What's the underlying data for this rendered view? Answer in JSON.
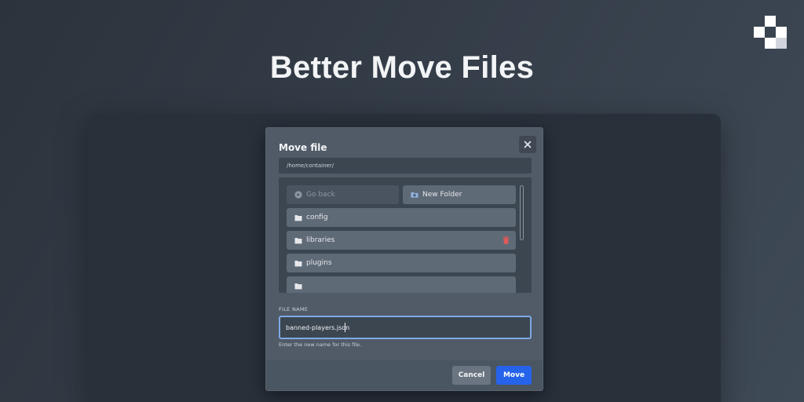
{
  "hero": {
    "title": "Better Move Files"
  },
  "brand": {
    "logo_icon": "pixel-block-logo"
  },
  "colors": {
    "accent": "#2563eb",
    "danger": "#e05a5a",
    "focus_ring": "#7fa9e6"
  },
  "modal": {
    "title": "Move file",
    "close_icon": "close-icon",
    "path": "/home/container/",
    "browser": {
      "go_back_label": "Go back",
      "new_folder_label": "New Folder",
      "folders": [
        {
          "name": "config",
          "icon": "folder-icon"
        },
        {
          "name": "libraries",
          "icon": "folder-icon",
          "action_icon": "trash-icon"
        },
        {
          "name": "plugins",
          "icon": "folder-icon"
        },
        {
          "name": "",
          "icon": "folder-icon"
        }
      ]
    },
    "file_name": {
      "label": "FILE NAME",
      "value": "banned-players.json",
      "helper": "Enter the new name for this file."
    },
    "footer": {
      "cancel_label": "Cancel",
      "move_label": "Move"
    }
  }
}
